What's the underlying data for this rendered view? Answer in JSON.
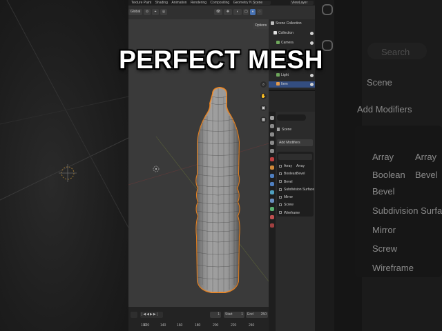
{
  "overlay": {
    "title": "PERFECT MESH"
  },
  "menubar": {
    "items": [
      "Texture Paint",
      "Shading",
      "Animation",
      "Rendering",
      "Compositing",
      "Geometry Nodes"
    ],
    "scene": "Scene",
    "view_layer": "ViewLayer"
  },
  "viewport": {
    "orientation": "Global",
    "options_label": "Options",
    "object": "bottle mesh (selected, orange outline)"
  },
  "outliner": {
    "rows": [
      {
        "label": "Scene Collection",
        "icon_color": "#bfbfbf"
      },
      {
        "label": "Collection",
        "icon_color": "#e0e0e0"
      },
      {
        "label": "Camera",
        "icon_color": "#6fa85c"
      },
      {
        "label": "Light",
        "icon_color": "#6fa85c"
      },
      {
        "label": "Item",
        "icon_color": "#e39a4c",
        "selected": true
      }
    ]
  },
  "properties": {
    "search_placeholder": "",
    "scene_label": "Scene",
    "add_modifier_label": "Add Modifiers",
    "modifiers": [
      {
        "label": "Array",
        "alt": "Array"
      },
      {
        "label": "Boolean",
        "alt": "Bevel"
      },
      {
        "label": "Bevel",
        "alt": ""
      },
      {
        "label": "Subdivision Surface",
        "alt": ""
      },
      {
        "label": "Mirror",
        "alt": ""
      },
      {
        "label": "Screw",
        "alt": ""
      },
      {
        "label": "Wireframe",
        "alt": ""
      }
    ]
  },
  "timeline": {
    "current_frame": "1",
    "start_label": "Start",
    "start_value": "1",
    "end_label": "End",
    "end_value": "250",
    "ruler": [
      "100",
      "120",
      "140",
      "160",
      "180",
      "200",
      "220",
      "240"
    ]
  },
  "background_right": {
    "search": "Search",
    "scene": "Scene",
    "add_modifiers": "Add Modifiers",
    "items": [
      "Array",
      "Boolean",
      "Bevel",
      "Subdivision Surface",
      "Mirror",
      "Screw",
      "Wireframe"
    ],
    "alt_items": [
      "Array",
      "Bevel"
    ]
  },
  "colors": {
    "selection_outline": "#e8801c",
    "accent_blue": "#334d80",
    "viewport_bg": "#3a3a3a"
  }
}
